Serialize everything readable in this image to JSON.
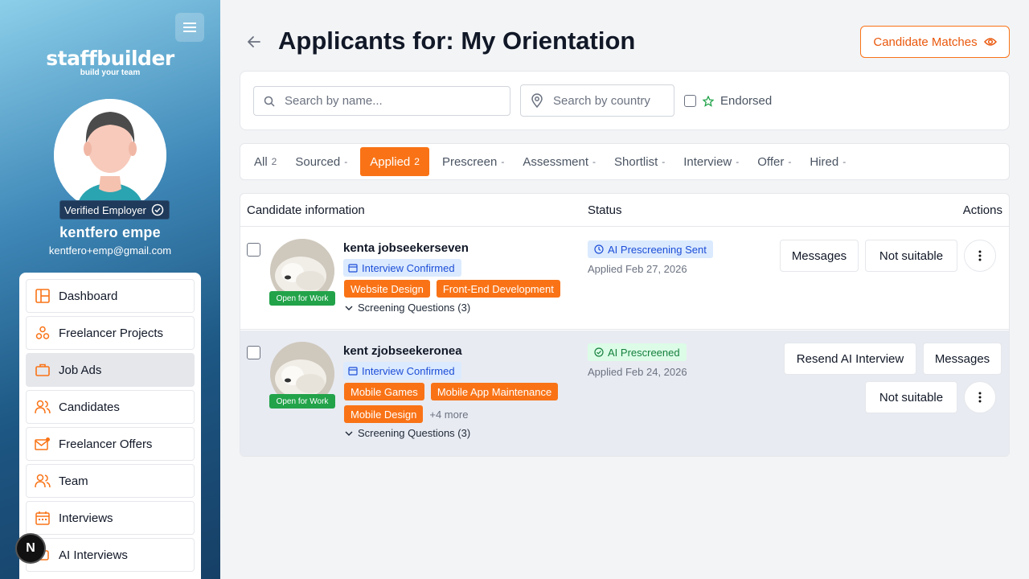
{
  "sidebar": {
    "logo_main": "staffbuilder",
    "logo_sub": "build your team",
    "verified_label": "Verified Employer",
    "user_name": "kentfero empe",
    "user_email": "kentfero+emp@gmail.com",
    "items": [
      {
        "label": "Dashboard",
        "icon": "dashboard-icon"
      },
      {
        "label": "Freelancer Projects",
        "icon": "projects-icon"
      },
      {
        "label": "Job Ads",
        "icon": "briefcase-icon"
      },
      {
        "label": "Candidates",
        "icon": "users-icon"
      },
      {
        "label": "Freelancer Offers",
        "icon": "mail-icon"
      },
      {
        "label": "Team",
        "icon": "team-icon"
      },
      {
        "label": "Interviews",
        "icon": "calendar-icon"
      },
      {
        "label": "AI Interviews",
        "icon": "ai-icon"
      }
    ],
    "active_item": "Job Ads",
    "n_badge": "N"
  },
  "header": {
    "title": "Applicants for: My Orientation",
    "candidate_matches_label": "Candidate Matches"
  },
  "filters": {
    "name_placeholder": "Search by name...",
    "country_placeholder": "Search by country",
    "endorsed_label": "Endorsed"
  },
  "tabs": [
    {
      "label": "All",
      "count": "2"
    },
    {
      "label": "Sourced",
      "count": "-"
    },
    {
      "label": "Applied",
      "count": "2"
    },
    {
      "label": "Prescreen",
      "count": "-"
    },
    {
      "label": "Assessment",
      "count": "-"
    },
    {
      "label": "Shortlist",
      "count": "-"
    },
    {
      "label": "Interview",
      "count": "-"
    },
    {
      "label": "Offer",
      "count": "-"
    },
    {
      "label": "Hired",
      "count": "-"
    }
  ],
  "active_tab": "Applied",
  "table": {
    "headers": {
      "candidate": "Candidate information",
      "status": "Status",
      "actions": "Actions"
    },
    "rows": [
      {
        "name": "kenta jobseekerseven",
        "open_for_work": "Open for Work",
        "interview_badge": "Interview Confirmed",
        "skills": [
          "Website Design",
          "Front-End Development"
        ],
        "more": "",
        "screening": "Screening Questions (3)",
        "status": "AI Prescreening Sent",
        "applied": "Applied Feb 27, 2026",
        "actions": {
          "messages": "Messages",
          "not_suitable": "Not suitable"
        }
      },
      {
        "name": "kent zjobseekeronea",
        "open_for_work": "Open for Work",
        "interview_badge": "Interview Confirmed",
        "skills": [
          "Mobile Games",
          "Mobile App Maintenance",
          "Mobile Design"
        ],
        "more": "+4 more",
        "screening": "Screening Questions (3)",
        "status": "AI Prescreened",
        "applied": "Applied Feb 24, 2026",
        "actions": {
          "resend": "Resend AI Interview",
          "messages": "Messages",
          "not_suitable": "Not suitable"
        }
      }
    ]
  },
  "colors": {
    "accent": "#f97316",
    "sidebar_dark": "#163f66",
    "status_blue": "#1d4ed8",
    "status_green": "#15803d",
    "open_work": "#22a34a"
  }
}
